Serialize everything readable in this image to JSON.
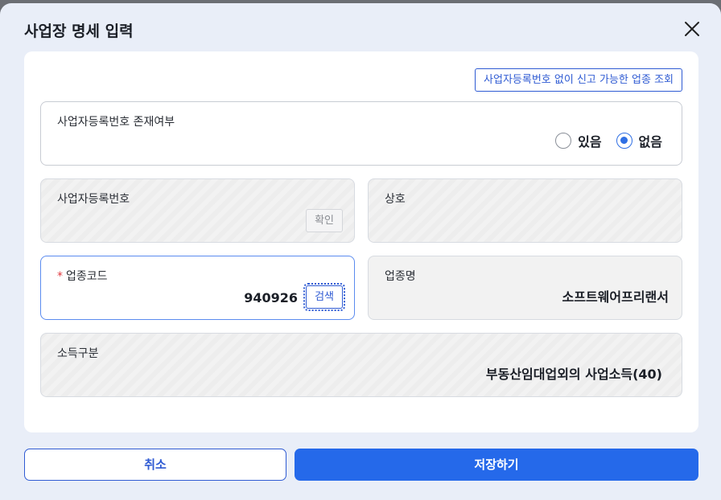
{
  "dialog": {
    "title": "사업장 명세 입력",
    "close_icon": "close-icon"
  },
  "lookup_button": "사업자등록번호 없이 신고 가능한 업종 조회",
  "has_bizno": {
    "label": "사업자등록번호 존재여부",
    "options": [
      {
        "label": "있음",
        "selected": false
      },
      {
        "label": "없음",
        "selected": true
      }
    ]
  },
  "bizno": {
    "label": "사업자등록번호",
    "confirm_button": "확인",
    "value": ""
  },
  "company_name": {
    "label": "상호",
    "value": ""
  },
  "industry_code": {
    "required_mark": "*",
    "label": "업종코드",
    "value": "940926",
    "search_button": "검색"
  },
  "industry_name": {
    "label": "업종명",
    "value": "소프트웨어프리랜서"
  },
  "income_type": {
    "label": "소득구분",
    "value": "부동산임대업외의 사업소득(40)"
  },
  "footer": {
    "cancel_label": "취소",
    "save_label": "저장하기"
  },
  "colors": {
    "accent": "#2569ea",
    "required": "#e0383e"
  }
}
